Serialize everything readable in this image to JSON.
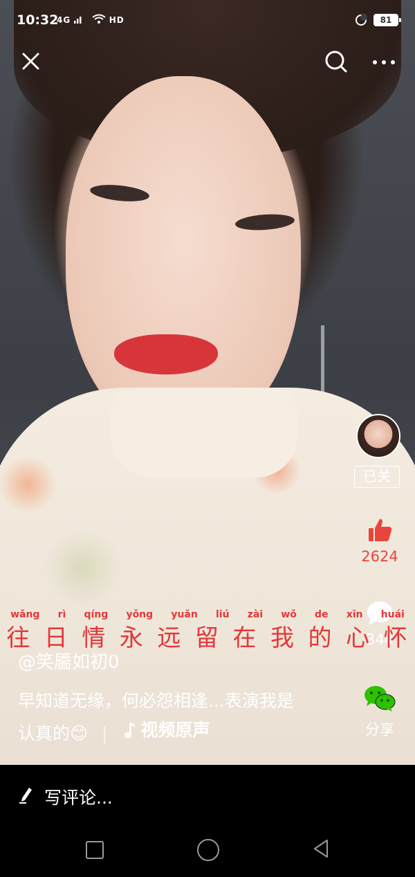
{
  "status_bar": {
    "time": "10:32",
    "network": "4G",
    "signal_label": "HD",
    "battery": "81"
  },
  "top_actions": {
    "close_icon": "close-icon",
    "search_icon": "search-icon",
    "more_icon": "more-dots-icon"
  },
  "creator": {
    "follow_label": "已关"
  },
  "stats": {
    "likes": "2624",
    "comments": "344",
    "share_label": "分享"
  },
  "lyrics": {
    "pinyin": [
      "wǎng",
      "rì",
      "qíng",
      "yǒng",
      "yuǎn",
      "liú",
      "zài",
      "wǒ",
      "de",
      "xīn",
      "huái"
    ],
    "hanzi": [
      "往",
      "日",
      "情",
      "永",
      "远",
      "留",
      "在",
      "我",
      "的",
      "心",
      "怀"
    ]
  },
  "post": {
    "author": "@笑靥如初0",
    "description_line1": "早知道无缘，何必怨相逢...表演我是",
    "description_line2": "认真的😊",
    "music_label": "视频原声"
  },
  "comment_bar": {
    "placeholder": "写评论..."
  },
  "colors": {
    "like_red": "#e8453c",
    "lyric_red": "#e33838",
    "wechat_green": "#2dc100"
  }
}
